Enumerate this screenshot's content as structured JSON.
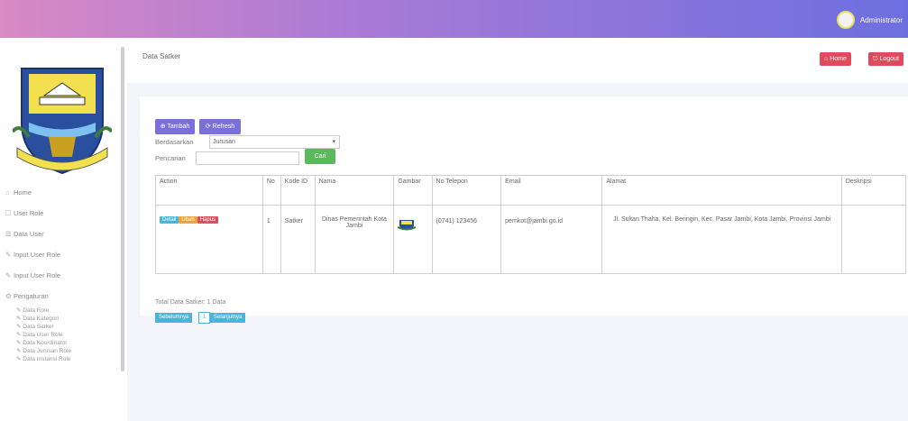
{
  "topbar": {
    "user": "Administrator"
  },
  "sidebar": {
    "menu": [
      {
        "icon": "home-icon",
        "label": "Home"
      },
      {
        "icon": "user-icon",
        "label": "User Role"
      },
      {
        "icon": "list-icon",
        "label": "Data User"
      },
      {
        "icon": "edit-icon",
        "label": "Input User Role"
      },
      {
        "icon": "edit-icon",
        "label": "Input User Role"
      },
      {
        "icon": "cog-icon",
        "label": "Pengaturan"
      }
    ],
    "submenu": [
      "Data Role",
      "Data Kategori",
      "Data Satker",
      "Data User Role",
      "Data Koordinator",
      "Data Jurusan Role",
      "Data Instansi Role"
    ]
  },
  "header": {
    "title": "Data Satker",
    "btn_home": "Home",
    "btn_logout": "Logout"
  },
  "toolbar": {
    "btn_tambah": "Tambah",
    "btn_refresh": "Refresh",
    "filter_label": "Berdasarkan",
    "filter_value": "Jurusan",
    "search_label": "Pencarian",
    "search_value": "",
    "btn_cari": "Cari"
  },
  "table": {
    "headers": [
      "Action",
      "No",
      "Kode ID",
      "Nama",
      "Gambar",
      "No Telepon",
      "Email",
      "Alamat",
      "Deskripsi"
    ],
    "rows": [
      {
        "actions": [
          "Detail",
          "Ubah",
          "Hapus"
        ],
        "no": "1",
        "kode": "Satker",
        "nama": "Dinas Pemerintah Kota Jambi",
        "telepon": "(0741) 123456",
        "email": "pemkot@jambi.go.id",
        "alamat": "Jl. Sultan Thaha, Kel. Beringin, Kec. Pasar Jambi, Kota Jambi, Provinsi Jambi",
        "deskripsi": ""
      }
    ]
  },
  "summary": {
    "total": "Total Data Satker: 1 Data",
    "pager": [
      "Sebelumnya",
      "1",
      "Selanjutnya"
    ]
  },
  "colors": {
    "accent": "#7b6fd8",
    "danger": "#e04a5d",
    "success": "#5cb85c",
    "info": "#48b6d8"
  }
}
